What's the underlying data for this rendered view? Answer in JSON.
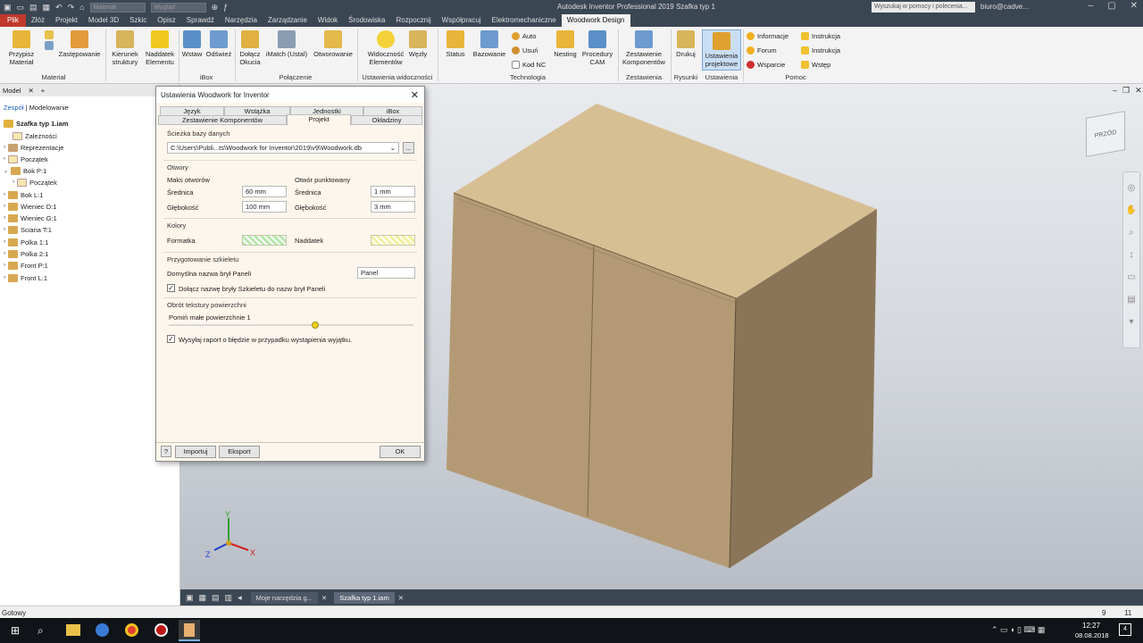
{
  "titlebar": {
    "app_title": "Autodesk Inventor Professional 2019   Szafka typ 1",
    "material_combo": "Materiał",
    "appearance_combo": "Wygląd",
    "search_placeholder": "Wyszukaj w pomocy i polecenia...",
    "user": "biuro@cadve..."
  },
  "menu": [
    "Plik",
    "Złóż",
    "Projekt",
    "Model 3D",
    "Szkic",
    "Opisz",
    "Sprawdź",
    "Narzędzia",
    "Zarządzanie",
    "Widok",
    "Środowiska",
    "Rozpocznij",
    "Współpracuj",
    "Elektromechaniczne",
    "Woodwork Design"
  ],
  "ribbon": {
    "przypisz": "Przypisz\nMateriał",
    "zastepowanie": "Zastępowanie",
    "kierunek": "Kierunek\nstruktury",
    "naddatek": "Naddatek\nElementu",
    "wstaw": "Wstaw",
    "odswiez": "Odśwież",
    "dolacz": "Dołącz\nOkucia",
    "imatch": "iMatch (Ustal)",
    "otworowanie": "Otworowanie",
    "widocznosc": "Widoczność\nElementów",
    "wezly": "Węzły",
    "status": "Status",
    "bazowanie": "Bazowanie",
    "auto": "Auto",
    "usun": "Usuń",
    "kodnc": "Kod NC",
    "nesting": "Nesting",
    "procedury": "Procedury\nCAM",
    "zestawienie": "Zestawienie\nKomponentów",
    "drukuj": "Drukuj",
    "ustawienia": "Ustawienia\nprojektowe",
    "informacje": "Informacje",
    "forum": "Forum",
    "wsparcie": "Wsparcie",
    "instrukcja1": "Instrukcja",
    "instrukcja2": "Instrukcja",
    "wstep": "Wstęp",
    "groups": {
      "material": "Materiał",
      "ibox": "iBox",
      "polaczenie": "Połączenie",
      "ustawienia_widocznosci": "Ustawienia widoczności",
      "technologia": "Technologia",
      "zestawienia": "Zestawienia",
      "rysunki": "Rysunki",
      "ustawienia": "Ustawienia",
      "pomoc": "Pomoc"
    }
  },
  "browser": {
    "tab_model": "Model",
    "sub1": "Zespół",
    "sub2": "Modelowanie",
    "root": "Szafka typ 1.iam",
    "items": [
      "Zależności",
      "Reprezentacje",
      "Początek",
      "Bok P:1",
      "Początek",
      "Bok L:1",
      "Wieniec D:1",
      "Wieniec G:1",
      "Sciana T:1",
      "Polka 1:1",
      "Polka 2:1",
      "Front P:1",
      "Front L:1"
    ]
  },
  "dialog": {
    "title": "Ustawienia Woodwork for Inventor",
    "tabs_row1": [
      "Język",
      "Wstążka",
      "Jednostki",
      "iBox"
    ],
    "tabs_row2": [
      "Zestawienie Komponentów",
      "Projekt",
      "Okładziny"
    ],
    "db_section": "Ścieżka bazy danych",
    "db_path": "C:\\Users\\Publi...ts\\Woodwork for Inventor\\2019\\v9\\Woodwork.db",
    "browse": "...",
    "holes_section": "Otwory",
    "max_holes": "Maks otworów",
    "point_hole": "Otwór punktowany",
    "diameter": "Średnica",
    "depth": "Głębokość",
    "max_diameter": "60 mm",
    "max_depth": "100 mm",
    "pt_diameter": "1 mm",
    "pt_depth": "3 mm",
    "colors_section": "Kolory",
    "formatka": "Formatka",
    "naddatek": "Naddatek",
    "colors": {
      "formatka": "#b9e6b0",
      "naddatek": "#f3f0a0"
    },
    "skeleton_section": "Przygotowanie szkieletu",
    "default_panel_name_label": "Domyślna nazwa brył Paneli",
    "default_panel_name": "Panel",
    "append_skeleton": "Dołącz nazwę bryły Szkieletu do nazw brył Paneli",
    "append_skeleton_checked": true,
    "texture_section": "Obrót tekstury powierzchni",
    "skip_small": "Pomiń małe powierzchnie 1",
    "slider_fraction": 0.6,
    "send_report": "Wysyłaj raport o błędzie w przypadku wystąpienia wyjątku.",
    "send_report_checked": true,
    "import": "Importuj",
    "export": "Eksport",
    "ok": "OK",
    "help": "?"
  },
  "viewport": {
    "viewcube": "PRZÓD",
    "axes": {
      "x": "X",
      "y": "Y",
      "z": "Z"
    }
  },
  "doc_tabs": [
    "Moje narzędzia g...",
    "Szafka typ 1.iam"
  ],
  "status": {
    "ready": "Gotowy",
    "n1": "9",
    "n2": "11"
  },
  "taskbar": {
    "time": "12:27",
    "date": "08.08.2018",
    "notif": "4"
  }
}
